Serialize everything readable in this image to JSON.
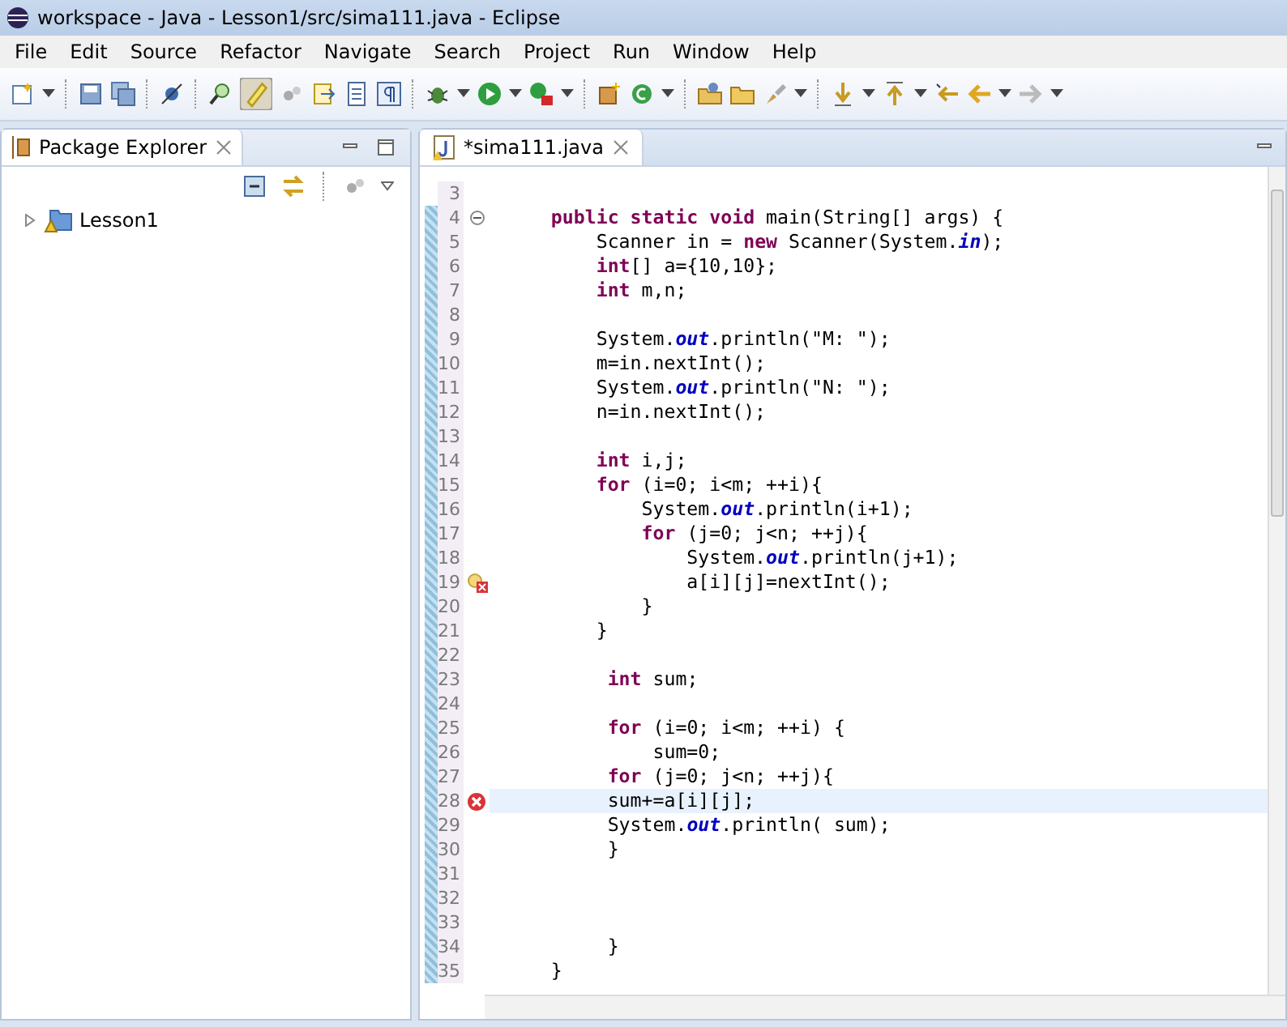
{
  "window": {
    "title": "workspace - Java - Lesson1/src/sima111.java - Eclipse"
  },
  "menu": [
    "File",
    "Edit",
    "Source",
    "Refactor",
    "Navigate",
    "Search",
    "Project",
    "Run",
    "Window",
    "Help"
  ],
  "package_explorer": {
    "title": "Package Explorer",
    "items": [
      {
        "label": "Lesson1",
        "expanded": false,
        "warning": true
      }
    ]
  },
  "editor": {
    "tab": {
      "title": "*sima111.java",
      "selected": true,
      "dirty": true
    },
    "lines": [
      {
        "no": "3",
        "kind": "plain",
        "current": false
      },
      {
        "no": "4",
        "kind": "fold",
        "text": "    **public static void** main(String[] args) {",
        "current": false
      },
      {
        "no": "5",
        "kind": "plain",
        "text": "        Scanner in = **new** Scanner(System.*in*);",
        "current": false
      },
      {
        "no": "6",
        "kind": "plain",
        "text": "        **int**[] a={10,10};",
        "current": false
      },
      {
        "no": "7",
        "kind": "plain",
        "text": "        **int** m,n;",
        "current": false
      },
      {
        "no": "8",
        "kind": "plain",
        "current": false
      },
      {
        "no": "9",
        "kind": "plain",
        "text": "        System.*out*.println(\"M: \");",
        "current": false
      },
      {
        "no": "10",
        "kind": "plain",
        "text": "        m=in.nextInt();",
        "current": false
      },
      {
        "no": "11",
        "kind": "plain",
        "text": "        System.*out*.println(\"N: \");",
        "current": false
      },
      {
        "no": "12",
        "kind": "plain",
        "text": "        n=in.nextInt();",
        "current": false
      },
      {
        "no": "13",
        "kind": "plain",
        "current": false
      },
      {
        "no": "14",
        "kind": "plain",
        "text": "        **int** i,j;",
        "current": false
      },
      {
        "no": "15",
        "kind": "plain",
        "text": "        **for** (i=0; i<m; ++i){",
        "current": false
      },
      {
        "no": "16",
        "kind": "plain",
        "text": "            System.*out*.println(i+1);",
        "current": false
      },
      {
        "no": "17",
        "kind": "plain",
        "text": "            **for** (j=0; j<n; ++j){",
        "current": false
      },
      {
        "no": "18",
        "kind": "plain",
        "text": "                System.*out*.println(j+1);",
        "current": false
      },
      {
        "no": "19",
        "kind": "warning",
        "text": "                a[i][j]=nextInt();",
        "current": false
      },
      {
        "no": "20",
        "kind": "plain",
        "text": "            }",
        "current": false
      },
      {
        "no": "21",
        "kind": "plain",
        "text": "        }",
        "current": false
      },
      {
        "no": "22",
        "kind": "plain",
        "current": false
      },
      {
        "no": "23",
        "kind": "plain",
        "text": "         **int** sum;",
        "current": false
      },
      {
        "no": "24",
        "kind": "plain",
        "current": false
      },
      {
        "no": "25",
        "kind": "plain",
        "text": "         **for** (i=0; i<m; ++i) {",
        "current": false
      },
      {
        "no": "26",
        "kind": "plain",
        "text": "             sum=0;",
        "current": false
      },
      {
        "no": "27",
        "kind": "plain",
        "text": "         **for** (j=0; j<n; ++j){",
        "current": false
      },
      {
        "no": "28",
        "kind": "error",
        "text": "         sum+=a[i][j];",
        "current": true
      },
      {
        "no": "29",
        "kind": "plain",
        "text": "         System.*out*.println( sum);",
        "current": false
      },
      {
        "no": "30",
        "kind": "plain",
        "text": "         }",
        "current": false
      },
      {
        "no": "31",
        "kind": "plain",
        "current": false
      },
      {
        "no": "32",
        "kind": "plain",
        "current": false
      },
      {
        "no": "33",
        "kind": "plain",
        "current": false
      },
      {
        "no": "34",
        "kind": "plain",
        "text": "         }",
        "current": false
      },
      {
        "no": "35",
        "kind": "plain",
        "text": "    }",
        "current": false
      }
    ]
  }
}
